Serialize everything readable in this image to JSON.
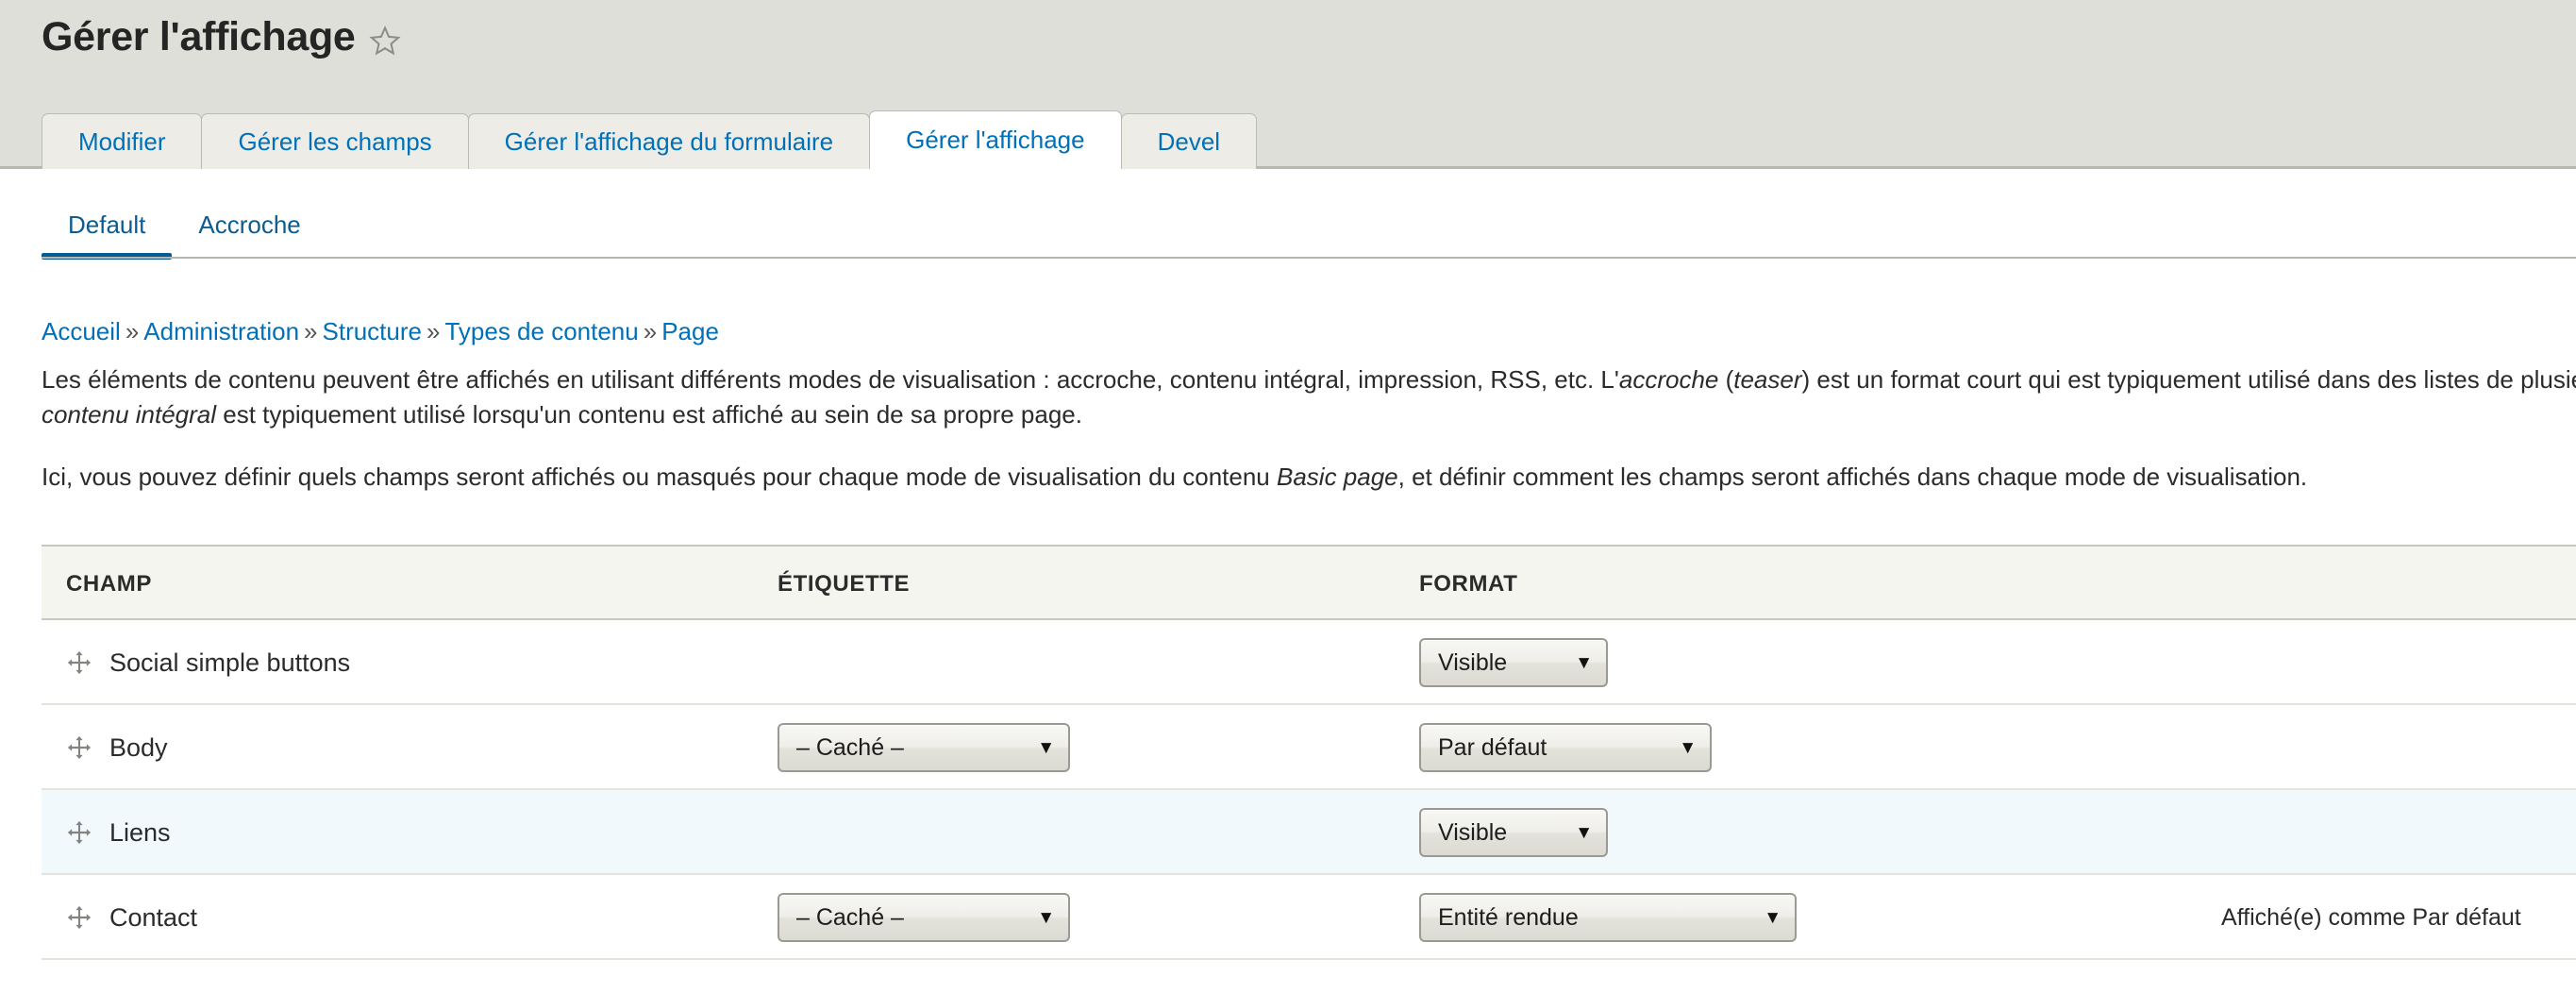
{
  "page": {
    "title": "Gérer l'affichage",
    "star_icon": "star-outline-icon"
  },
  "primary_tabs": [
    {
      "label": "Modifier",
      "active": false
    },
    {
      "label": "Gérer les champs",
      "active": false
    },
    {
      "label": "Gérer l'affichage du formulaire",
      "active": false
    },
    {
      "label": "Gérer l'affichage",
      "active": true
    },
    {
      "label": "Devel",
      "active": false
    }
  ],
  "secondary_tabs": [
    {
      "label": "Default",
      "active": true
    },
    {
      "label": "Accroche",
      "active": false
    }
  ],
  "breadcrumb": {
    "separator": "»",
    "items": [
      "Accueil",
      "Administration",
      "Structure",
      "Types de contenu",
      "Page"
    ]
  },
  "intro": {
    "paragraph_1_a": "Les éléments de contenu peuvent être affichés en utilisant différents modes de visualisation : accroche, contenu intégral, impression, RSS, etc. L'",
    "paragraph_1_em1": "accroche",
    "paragraph_1_b": " (",
    "paragraph_1_em2": "teaser",
    "paragraph_1_c": ") est un format court qui est typiquement utilisé dans des listes de plusieurs contenus. Le ",
    "paragraph_1_em3": "contenu intégral",
    "paragraph_1_d": " est typiquement utilisé lorsqu'un contenu est affiché au sein de sa propre page.",
    "paragraph_2_a": "Ici, vous pouvez définir quels champs seront affichés ou masqués pour chaque mode de visualisation du contenu ",
    "paragraph_2_em": "Basic page",
    "paragraph_2_b": ", et définir comment les champs seront affichés dans chaque mode de visualisation."
  },
  "table": {
    "headers": {
      "field": "CHAMP",
      "label": "ÉTIQUETTE",
      "format": "FORMAT"
    },
    "rows": [
      {
        "drag_icon": "drag-move-icon",
        "field": "Social simple buttons",
        "label_select": null,
        "format_select": "Visible",
        "summary": ""
      },
      {
        "drag_icon": "drag-move-icon",
        "field": "Body",
        "label_select": "– Caché –",
        "format_select": "Par défaut",
        "summary": ""
      },
      {
        "drag_icon": "drag-move-icon",
        "field": "Liens",
        "label_select": null,
        "format_select": "Visible",
        "summary": ""
      },
      {
        "drag_icon": "drag-move-icon",
        "field": "Contact",
        "label_select": "– Caché –",
        "format_select": "Entité rendue",
        "summary": "Affiché(e) comme Par défaut"
      }
    ]
  },
  "colors": {
    "header_band": "#dfdfd9",
    "link": "#0071b8",
    "active_subtab": "#0a5b8e",
    "row_highlight": "#f2f9fd",
    "table_head_bg": "#f5f5f0"
  },
  "select_arrow_glyph": "▼"
}
